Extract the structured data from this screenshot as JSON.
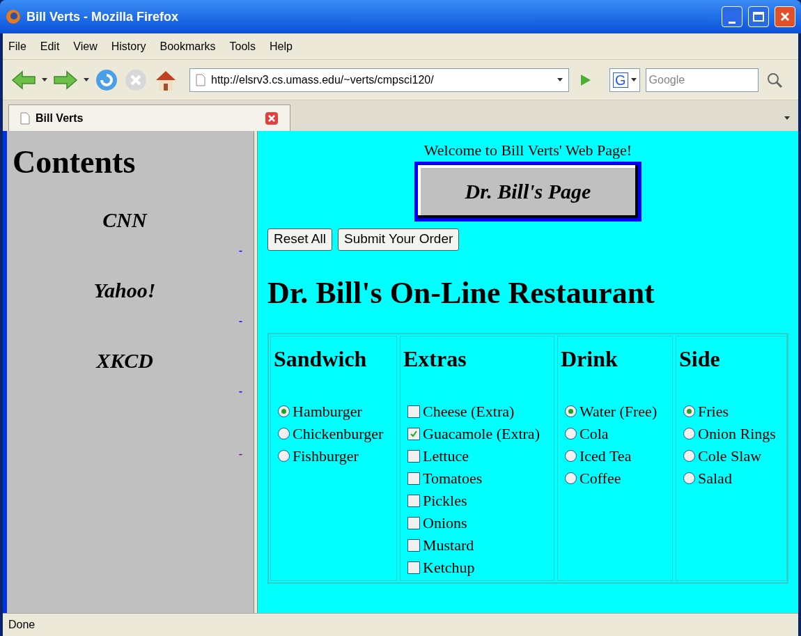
{
  "window": {
    "title": "Bill Verts - Mozilla Firefox"
  },
  "menu": [
    "File",
    "Edit",
    "View",
    "History",
    "Bookmarks",
    "Tools",
    "Help"
  ],
  "address": {
    "value": "http://elsrv3.cs.umass.edu/~verts/cmpsci120/"
  },
  "search": {
    "placeholder": "Google",
    "engine_letter": "G"
  },
  "tabs": [
    {
      "label": "Bill Verts",
      "selected": true
    }
  ],
  "sidebar": {
    "title": "Contents",
    "links": [
      {
        "label": "CNN",
        "mark": "-",
        "color": "#0000ff"
      },
      {
        "label": "Yahoo!",
        "mark": "-",
        "color": "#0000ff"
      },
      {
        "label": "XKCD",
        "mark": "-",
        "color": "#0000ff"
      },
      {
        "mark": "-",
        "color": "#800080"
      }
    ]
  },
  "page": {
    "welcome": "Welcome to Bill Verts' Web Page!",
    "banner_button": "Dr. Bill's Page",
    "buttons": [
      "Reset All",
      "Submit Your Order"
    ],
    "heading": "Dr. Bill's On-Line Restaurant",
    "columns": [
      {
        "title": "Sandwich",
        "options": [
          {
            "kind": "radio",
            "label": "Hamburger",
            "selected": true
          },
          {
            "kind": "radio",
            "label": "Chickenburger",
            "selected": false
          },
          {
            "kind": "radio",
            "label": "Fishburger",
            "selected": false
          }
        ]
      },
      {
        "title": "Extras",
        "options": [
          {
            "kind": "checkbox",
            "label": "Cheese (Extra)",
            "checked": false
          },
          {
            "kind": "checkbox",
            "label": "Guacamole (Extra)",
            "checked": true
          },
          {
            "kind": "checkbox",
            "label": "Lettuce",
            "checked": false
          },
          {
            "kind": "checkbox",
            "label": "Tomatoes",
            "checked": false
          },
          {
            "kind": "checkbox",
            "label": "Pickles",
            "checked": false
          },
          {
            "kind": "checkbox",
            "label": "Onions",
            "checked": false
          },
          {
            "kind": "checkbox",
            "label": "Mustard",
            "checked": false
          },
          {
            "kind": "checkbox",
            "label": "Ketchup",
            "checked": false
          }
        ]
      },
      {
        "title": "Drink",
        "options": [
          {
            "kind": "radio",
            "label": "Water (Free)",
            "selected": true
          },
          {
            "kind": "radio",
            "label": "Cola",
            "selected": false
          },
          {
            "kind": "radio",
            "label": "Iced Tea",
            "selected": false
          },
          {
            "kind": "radio",
            "label": "Coffee",
            "selected": false
          }
        ]
      },
      {
        "title": "Side",
        "options": [
          {
            "kind": "radio",
            "label": "Fries",
            "selected": true
          },
          {
            "kind": "radio",
            "label": "Onion Rings",
            "selected": false
          },
          {
            "kind": "radio",
            "label": "Cole Slaw",
            "selected": false
          },
          {
            "kind": "radio",
            "label": "Salad",
            "selected": false
          }
        ]
      }
    ]
  },
  "status_bar": {
    "text": "Done"
  }
}
